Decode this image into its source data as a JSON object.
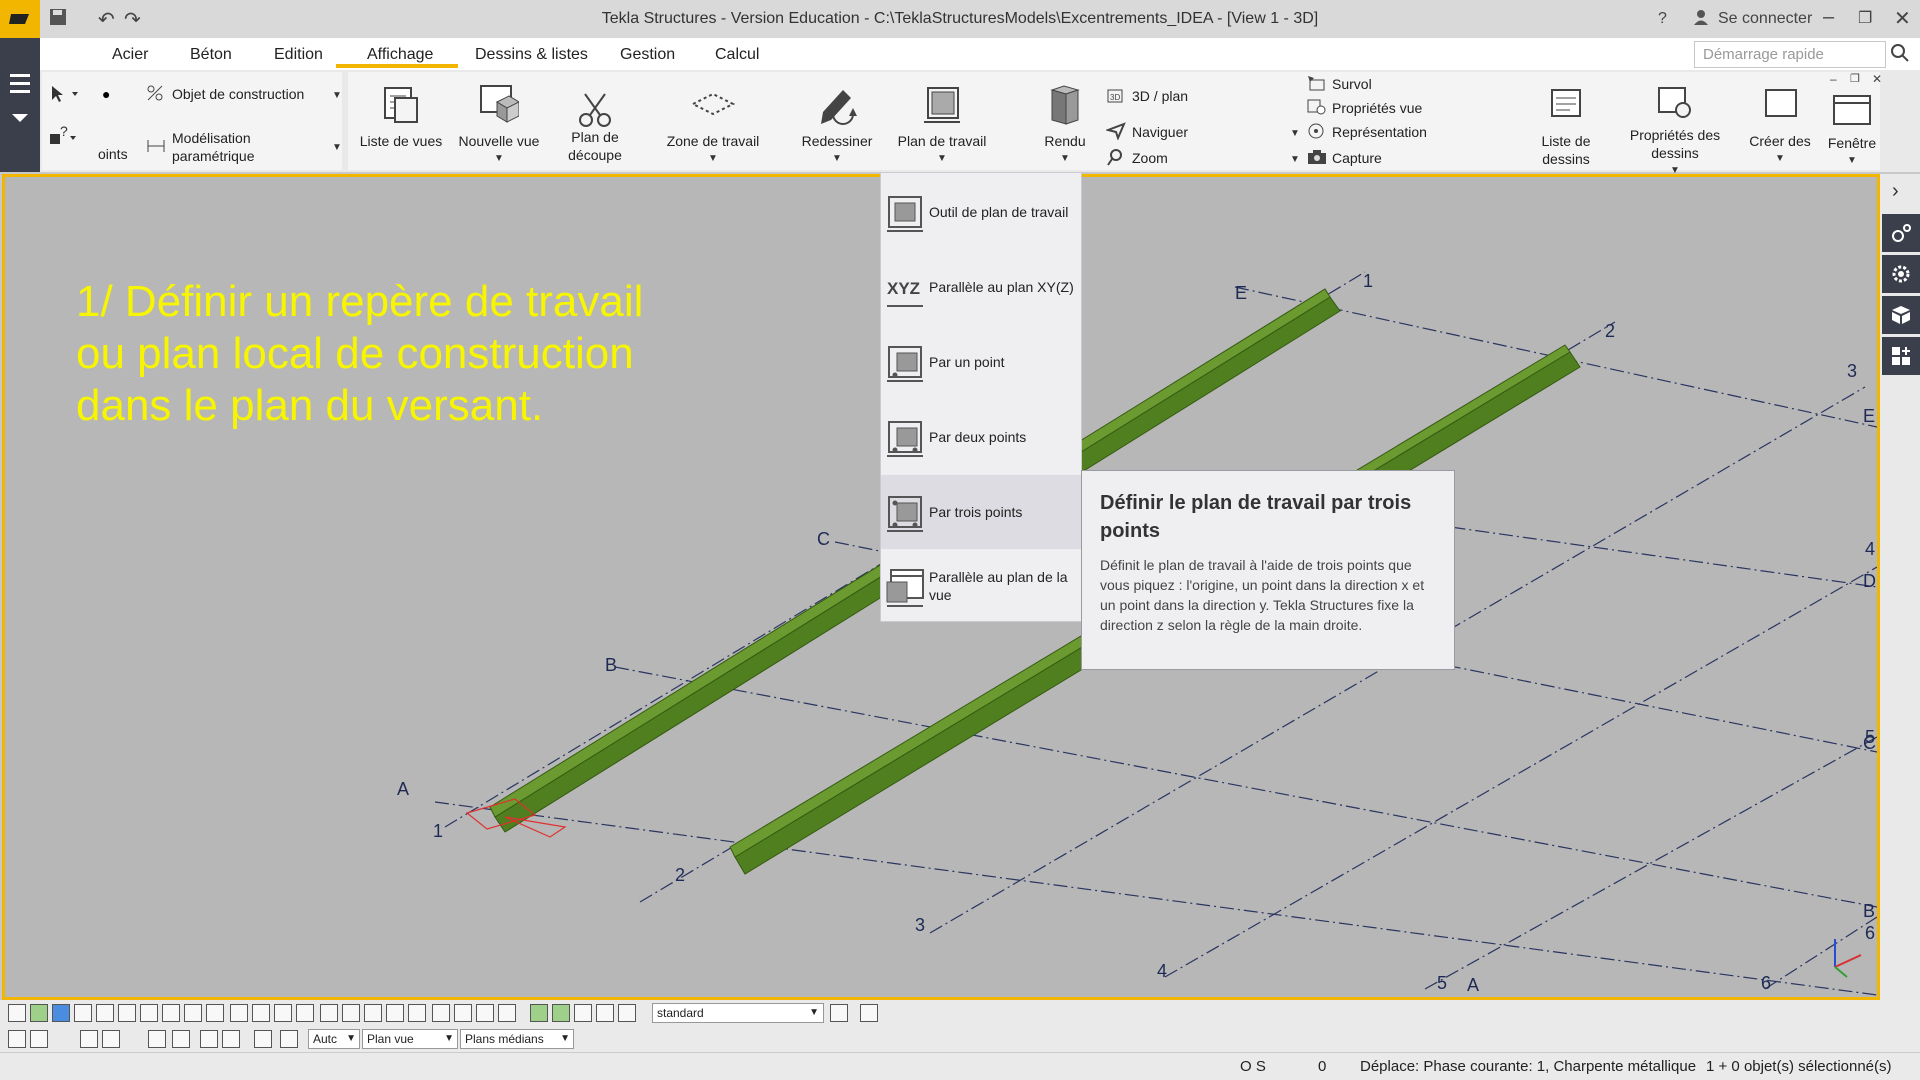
{
  "titlebar": {
    "title": "Tekla Structures - Version Education - C:\\TeklaStructuresModels\\Excentrements_IDEA - [View 1 - 3D]",
    "help": "?",
    "login": "Se connecter"
  },
  "menu": {
    "tabs": [
      "Acier",
      "Béton",
      "Edition",
      "Affichage",
      "Dessins & listes",
      "Gestion",
      "Calcul"
    ],
    "active_tab": "Affichage",
    "quick_search_placeholder": "Démarrage rapide"
  },
  "ribbon": {
    "points_label": "oints",
    "construction_object": "Objet de construction",
    "parametric_modeling_1": "Modélisation",
    "parametric_modeling_2": "paramétrique",
    "view_list": "Liste de vues",
    "new_view": "Nouvelle vue",
    "clip_plane_1": "Plan de",
    "clip_plane_2": "découpe",
    "work_area": "Zone de travail",
    "redraw": "Redessiner",
    "work_plane": "Plan de travail",
    "render": "Rendu",
    "view_3d_plan": "3D / plan",
    "navigate": "Naviguer",
    "zoom": "Zoom",
    "hover": "Survol",
    "view_properties": "Propriétés vue",
    "representation": "Représentation",
    "capture": "Capture",
    "drawing_list": "Liste de dessins",
    "drawing_properties_1": "Propriétés des",
    "drawing_properties_2": "dessins",
    "create_drawings": "Créer des",
    "window": "Fenêtre"
  },
  "overlay": {
    "line1": "1/ Définir un repère de travail",
    "line2": "ou plan local de construction",
    "line3": "dans le plan du versant."
  },
  "dropdown": {
    "items": [
      {
        "label": "Outil de plan de travail"
      },
      {
        "label": "Parallèle au plan XY(Z)",
        "icon_text": "XYZ"
      },
      {
        "label": "Par un point"
      },
      {
        "label": "Par deux points"
      },
      {
        "label": "Par trois points"
      },
      {
        "label": "Parallèle au plan de la vue"
      }
    ]
  },
  "tooltip": {
    "title": "Définir le plan de travail par trois points",
    "body": "Définit le plan de travail à l'aide de trois points que vous piquez : l'origine, un point dans la direction x et un point dans la direction y. Tekla Structures fixe la direction z selon la règle de la main droite."
  },
  "grid_labels": {
    "letters": [
      "A",
      "B",
      "C",
      "E",
      "E",
      "D",
      "C",
      "B",
      "A"
    ],
    "numbers": [
      "1",
      "2",
      "3",
      "4",
      "5",
      "6",
      "1",
      "2",
      "3",
      "4",
      "5",
      "6"
    ]
  },
  "bottom": {
    "select_standard": "standard",
    "select_auto": "Autc",
    "select_plan_vue": "Plan vue",
    "select_plans_medians": "Plans médians"
  },
  "status": {
    "os": "O S",
    "zero": "0",
    "phase": "Déplace: Phase courante: 1, Charpente métallique",
    "selected": "1 + 0 objet(s) sélectionné(s)"
  },
  "colors": {
    "accent": "#f2b600",
    "beam": "#4f7f1f",
    "overlay_text": "#f7f500",
    "viewport_bg": "#b7b7b7"
  }
}
